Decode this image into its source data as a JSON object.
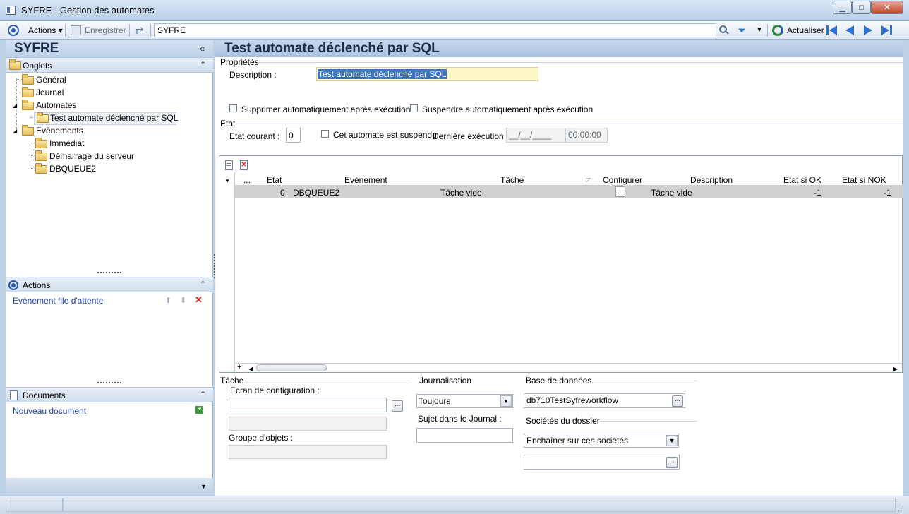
{
  "window": {
    "title": "SYFRE -  Gestion des automates"
  },
  "toolbar": {
    "actions_label": "Actions",
    "save_label": "Enregistrer",
    "search_value": "SYFRE",
    "refresh_label": "Actualiser"
  },
  "left": {
    "app_title": "SYFRE",
    "onglets_title": "Onglets",
    "tree": {
      "general": "Général",
      "journal": "Journal",
      "automates": "Automates",
      "test": "Test automate déclenché par SQL",
      "evenements": "Evènements",
      "immediat": "Immédiat",
      "demarrage": "Démarrage du serveur",
      "dbqueue": "DBQUEUE2"
    },
    "actions_title": "Actions",
    "action_item": "Evènement file d'attente",
    "documents_title": "Documents",
    "new_document": "Nouveau document"
  },
  "main": {
    "title": "Test automate déclenché par SQL",
    "proprietes_label": "Propriétés",
    "description_label": "Description :",
    "description_value": "Test automate déclenché par SQL",
    "cb_supprimer": "Supprimer automatiquement après exécution",
    "cb_suspendre": "Suspendre automatiquement après exécution",
    "etat_label": "Etat",
    "etat_courant_label": "Etat courant :",
    "etat_courant_value": "0",
    "cb_suspendu": "Cet automate est suspendu",
    "derniere_label": "Dernière exécution :",
    "derniere_date": "__/__/____",
    "derniere_time": "00:00:00",
    "grid": {
      "columns": [
        "...",
        "Etat",
        "Evènement",
        "Tâche",
        "Configurer",
        "Description",
        "Etat si OK",
        "Etat si NOK"
      ],
      "row": {
        "etat": "0",
        "evenement": "DBQUEUE2",
        "tache": "Tâche vide",
        "configurer": "...",
        "description": "Tâche vide",
        "ok": "-1",
        "nok": "-1"
      },
      "plus": "+"
    },
    "tache_group": "Tâche",
    "ecran_label": "Ecran de configuration :",
    "groupe_label": "Groupe d'objets :",
    "journal_group": "Journalisation",
    "journal_value": "Toujours",
    "sujet_label": "Sujet dans le Journal :",
    "base_group": "Base de données",
    "base_value": "db710TestSyfreworkflow",
    "societes_group": "Sociétés du dossier",
    "societes_value": "Enchaîner sur ces sociétés"
  }
}
